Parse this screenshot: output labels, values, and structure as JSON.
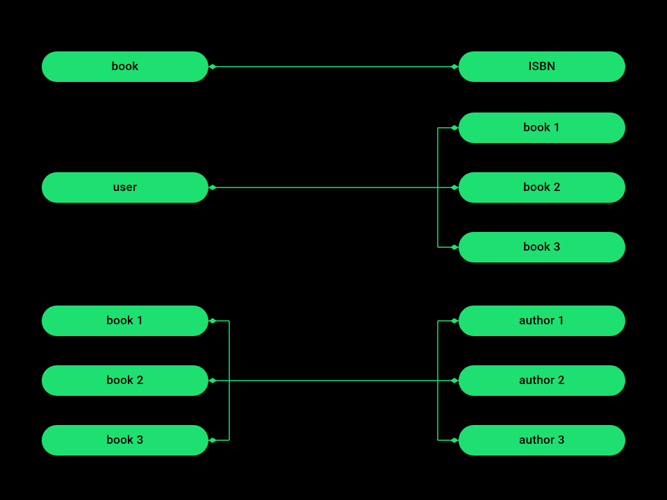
{
  "relations": {
    "one_to_one": {
      "left": {
        "label": "book"
      },
      "right": {
        "label": "ISBN"
      }
    },
    "one_to_many": {
      "left": {
        "label": "user"
      },
      "right": [
        {
          "label": "book 1"
        },
        {
          "label": "book 2"
        },
        {
          "label": "book 3"
        }
      ]
    },
    "many_to_many": {
      "left": [
        {
          "label": "book 1"
        },
        {
          "label": "book 2"
        },
        {
          "label": "book 3"
        }
      ],
      "right": [
        {
          "label": "author 1"
        },
        {
          "label": "author 2"
        },
        {
          "label": "author 3"
        }
      ]
    }
  },
  "colors": {
    "accent": "#1ee070",
    "background": "#000000"
  }
}
